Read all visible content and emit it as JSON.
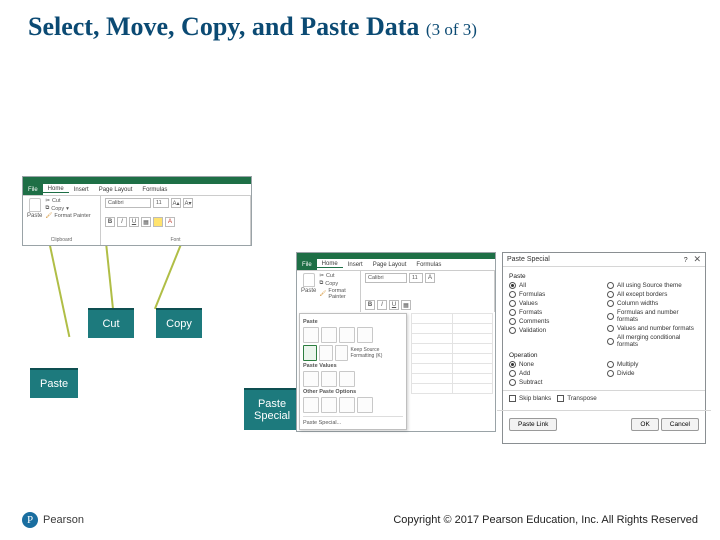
{
  "title": "Select, Move, Copy, and Paste Data",
  "title_suffix": "(3 of 3)",
  "badges": {
    "cut": "Cut",
    "copy": "Copy",
    "paste": "Paste",
    "paste_special": "Paste\nSpecial"
  },
  "ribbon": {
    "tabs": {
      "file": "File",
      "home": "Home",
      "insert": "Insert",
      "page_layout": "Page Layout",
      "formulas": "Formulas"
    },
    "clipboard": {
      "paste": "Paste",
      "cut": "Cut",
      "copy": "Copy",
      "format_painter": "Format Painter",
      "group": "Clipboard"
    },
    "font": {
      "name": "Calibri",
      "size": "11",
      "group": "Font"
    }
  },
  "paste_dropdown": {
    "section_paste": "Paste",
    "keep_source": "Keep Source Formatting (K)",
    "section_values": "Paste Values",
    "section_other": "Other Paste Options",
    "paste_special": "Paste Special..."
  },
  "dialog": {
    "title": "Paste Special",
    "help": "?",
    "section_paste": "Paste",
    "left_paste": [
      "All",
      "Formulas",
      "Values",
      "Formats",
      "Comments",
      "Validation"
    ],
    "right_paste": [
      "All using Source theme",
      "All except borders",
      "Column widths",
      "Formulas and number formats",
      "Values and number formats",
      "All merging conditional formats"
    ],
    "section_operation": "Operation",
    "left_op": [
      "None",
      "Add",
      "Subtract"
    ],
    "right_op": [
      "Multiply",
      "Divide"
    ],
    "skip_blanks": "Skip blanks",
    "transpose": "Transpose",
    "paste_link": "Paste Link",
    "ok": "OK",
    "cancel": "Cancel"
  },
  "footer": {
    "brand": "Pearson",
    "copyright": "Copyright © 2017 Pearson Education, Inc. All Rights Reserved"
  }
}
